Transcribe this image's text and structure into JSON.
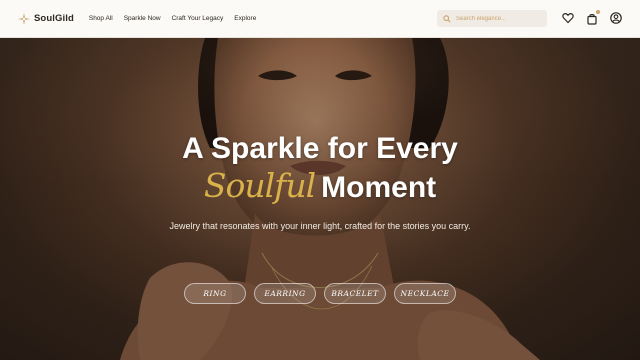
{
  "brand": {
    "name": "SoulGild",
    "accent": "#c9a46a"
  },
  "nav": {
    "links": [
      "Shop All",
      "Sparkle Now",
      "Craft Your Legacy",
      "Explore"
    ],
    "search_placeholder": "Search elegance...",
    "icons": [
      "search-icon",
      "heart-icon",
      "bag-icon",
      "user-icon"
    ]
  },
  "hero": {
    "headline_line1": "A Sparkle for Every",
    "headline_script": "Soulful",
    "headline_line2_rest": "Moment",
    "subtitle": "Jewelry that resonates with your inner light, crafted for the stories you carry.",
    "categories": [
      "RING",
      "EARRING",
      "BRACELET",
      "NECKLACE"
    ],
    "script_color": "#d9b24a"
  }
}
